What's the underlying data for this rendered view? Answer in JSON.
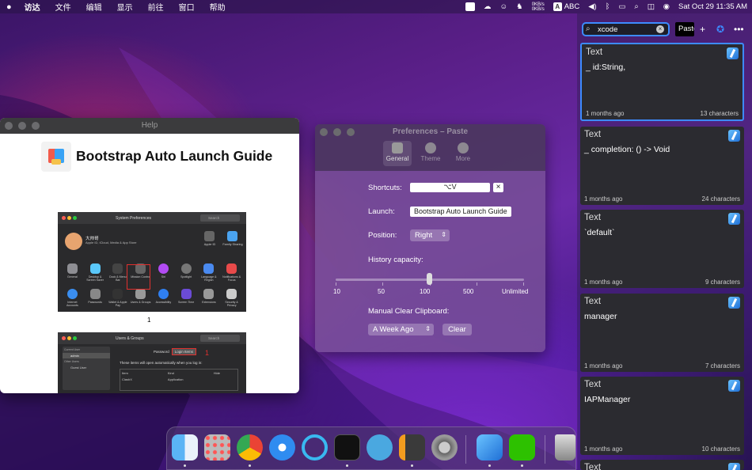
{
  "menubar": {
    "apple": "",
    "items": [
      "访达",
      "文件",
      "编辑",
      "显示",
      "前往",
      "窗口",
      "帮助"
    ],
    "status": {
      "net_up": "0KB/s",
      "net_down": "0KB/s",
      "input_source": "ABC",
      "input_badge": "A",
      "datetime": "Sat Oct 29  11:35 AM"
    }
  },
  "help_window": {
    "title": "Help",
    "heading": "Bootstrap Auto Launch Guide",
    "screenshot1": {
      "title": "System Preferences",
      "search": "Search",
      "user_name": "大帅哥",
      "user_sub": "Apple ID, iCloud, Media & App Store",
      "top_icons": [
        "Apple ID",
        "Family Sharing"
      ],
      "row1": [
        "General",
        "Desktop & Screen Saver",
        "Dock & Menu Bar",
        "Mission Control",
        "Siri",
        "Spotlight",
        "Language & Region",
        "Notifications & Focus"
      ],
      "row2": [
        "Internet Accounts",
        "Passwords",
        "Wallet & Apple Pay",
        "Users & Groups",
        "Accessibility",
        "Screen Time",
        "Extensions",
        "Security & Privacy"
      ],
      "caption": "1"
    },
    "screenshot2": {
      "title": "Users & Groups",
      "search": "Search",
      "tab_password": "Password",
      "tab_login": "Login Items",
      "marker": "1",
      "content": "These items will open automatically when you log in:",
      "cols": [
        "Item",
        "Kind",
        "Hide"
      ],
      "row": [
        "ClashX",
        "Application"
      ],
      "sidebar": [
        "Current User",
        "admin",
        "Other Users",
        "Guest User"
      ]
    }
  },
  "preferences": {
    "title": "Preferences – Paste",
    "tabs": [
      "General",
      "Theme",
      "More"
    ],
    "shortcuts_label": "Shortcuts:",
    "shortcut_value": "⌥V",
    "launch_label": "Launch:",
    "launch_value": "Bootstrap Auto Launch Guide",
    "position_label": "Position:",
    "position_value": "Right",
    "history_label": "History capacity:",
    "history_ticks": [
      "10",
      "50",
      "100",
      "500",
      "Unlimited"
    ],
    "history_level_fraction": 0.5,
    "manual_clear_label": "Manual Clear Clipboard:",
    "clear_period": "A Week Ago",
    "clear_button": "Clear"
  },
  "paste_panel": {
    "search_value": "xcode",
    "paste_label": "Paste",
    "cards": [
      {
        "type": "Text",
        "body": "_ id:String,",
        "age": "1 months ago",
        "chars": "13 characters"
      },
      {
        "type": "Text",
        "body": "_ completion: () -> Void",
        "age": "1 months ago",
        "chars": "24 characters"
      },
      {
        "type": "Text",
        "body": "`default`",
        "age": "1 months ago",
        "chars": "9 characters"
      },
      {
        "type": "Text",
        "body": "manager",
        "age": "1 months ago",
        "chars": "7 characters"
      },
      {
        "type": "Text",
        "body": "IAPManager",
        "age": "1 months ago",
        "chars": "10 characters"
      },
      {
        "type": "Text",
        "body": "",
        "age": "",
        "chars": ""
      }
    ]
  },
  "dock": {
    "apps": [
      "finder-icon",
      "launchpad-icon",
      "chrome-icon",
      "safari-icon",
      "quill-icon",
      "terminal-icon",
      "markdown-icon",
      "sublime-icon",
      "system-preferences-icon",
      "xcode-icon",
      "wechat-icon",
      "trash-icon"
    ]
  }
}
